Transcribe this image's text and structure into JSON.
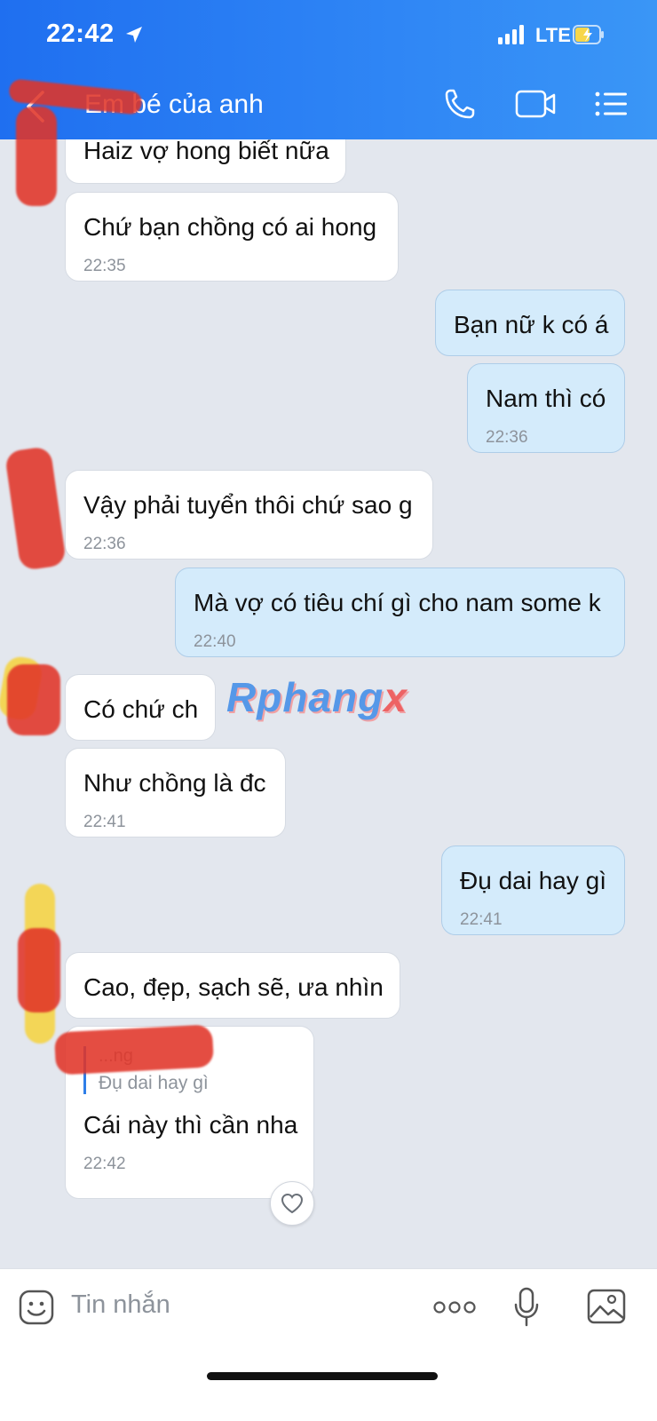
{
  "status_bar": {
    "time": "22:42",
    "network": "LTE"
  },
  "header": {
    "title": "Em bé của anh"
  },
  "messages": [
    {
      "side": "in",
      "text": "Haiz vợ hong biết nữa",
      "time": ""
    },
    {
      "side": "in",
      "text": "Chứ bạn chồng có ai hong",
      "time": "22:35"
    },
    {
      "side": "out",
      "text": "Bạn nữ k có á",
      "time": ""
    },
    {
      "side": "out",
      "text": "Nam thì có",
      "time": "22:36"
    },
    {
      "side": "in",
      "text": "Vậy phải tuyển thôi chứ sao g",
      "time": "22:36"
    },
    {
      "side": "out",
      "text": "Mà vợ có tiêu chí gì cho nam some k",
      "time": "22:40"
    },
    {
      "side": "in",
      "text": "Có chứ ch",
      "time": ""
    },
    {
      "side": "in",
      "text": "Như chồng là đc",
      "time": "22:41"
    },
    {
      "side": "out",
      "text": "Đụ dai hay gì",
      "time": "22:41"
    },
    {
      "side": "in",
      "text": "Cao, đẹp, sạch sẽ, ưa nhìn",
      "time": ""
    },
    {
      "side": "in",
      "text": "Cái này thì cần nha",
      "time": "22:42",
      "reply_to": {
        "name": "...ng",
        "text": "Đụ dai hay gì"
      }
    }
  ],
  "watermark": {
    "main": "Rphang",
    "accent": "x"
  },
  "input": {
    "placeholder": "Tin nhắn"
  },
  "colors": {
    "header": "#2f86f5",
    "outgoing_bubble": "#d4ebfb",
    "incoming_bubble": "#ffffff",
    "background": "#e3e7ee"
  }
}
